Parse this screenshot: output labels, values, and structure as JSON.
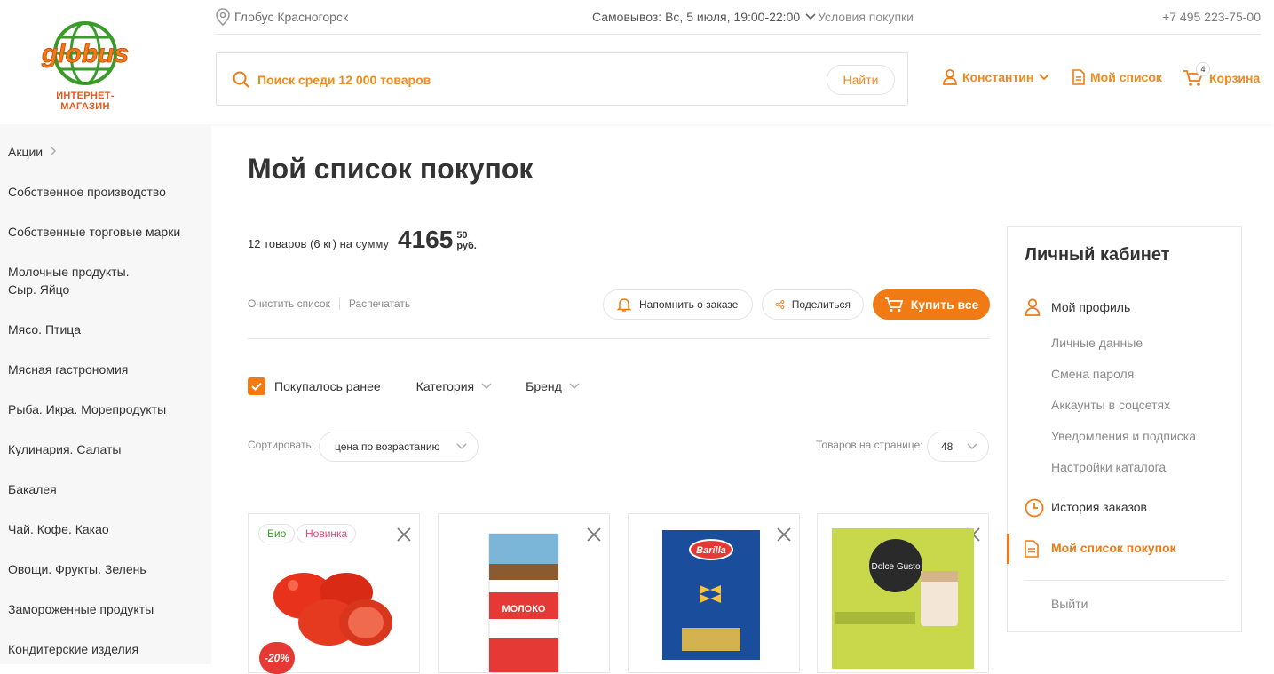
{
  "header": {
    "logo_text": "globus",
    "logo_subtitle": "ИНТЕРНЕТ-МАГАЗИН",
    "store": "Глобус Красногорск",
    "pickup": "Самовывоз: Вс, 5 июля, 19:00-22:00",
    "terms": "Условия покупки",
    "phone": "+7 495 223-75-00",
    "search_placeholder": "Поиск среди 12 000 товаров",
    "search_button": "Найти",
    "user": "Константин",
    "my_list": "Мой список",
    "cart": "Корзина",
    "cart_count": "4"
  },
  "sidebar": {
    "items": [
      "Акции",
      "Собственное производство",
      "Собственные торговые марки",
      "Молочные продукты.",
      "Сыр. Яйцо",
      "Мясо. Птица",
      "Мясная гастрономия",
      "Рыба. Икра. Морепродукты",
      "Кулинария. Салаты",
      "Бакалея",
      "Чай. Кофе. Какао",
      "Овощи. Фрукты. Зелень",
      "Замороженные продукты",
      "Кондитерские изделия"
    ]
  },
  "main": {
    "title": "Мой список покупок",
    "summary_text": "12 товаров (6 кг) на сумму",
    "sum_rub": "4165",
    "sum_kop": "50",
    "sum_cur": "руб.",
    "clear": "Очистить список",
    "print": "Распечатать",
    "remind": "Напомнить о заказе",
    "share": "Поделиться",
    "buy_all": "Купить все",
    "filter_bought": "Покупалось ранее",
    "filter_category": "Категория",
    "filter_brand": "Бренд",
    "sort_label": "Сортировать:",
    "sort_value": "цена по возрастанию",
    "per_page_label": "Товаров на странице:",
    "per_page_value": "48"
  },
  "products": [
    {
      "badges": [
        "Био",
        "Новинка"
      ],
      "discount": "-20%",
      "image": "tomatoes"
    },
    {
      "badges": [],
      "discount": "",
      "image": "milk-carton",
      "pack_text": "МОЛОКО"
    },
    {
      "badges": [],
      "discount": "",
      "image": "pasta-box",
      "pack_text": "Barilla"
    },
    {
      "badges": [],
      "discount": "",
      "image": "coffee-capsules",
      "pack_text": "Dolce Gusto"
    }
  ],
  "account": {
    "title": "Личный кабинет",
    "profile": "Мой профиль",
    "personal": "Личные данные",
    "password": "Смена пароля",
    "social": "Аккаунты в соцсетях",
    "notifications": "Уведомления и подписка",
    "catalog_settings": "Настройки каталога",
    "history": "История заказов",
    "my_list": "Мой список покупок",
    "logout": "Выйти"
  },
  "colors": {
    "accent": "#f07a14",
    "green": "#3a9a2a",
    "discount": "#e53935"
  }
}
